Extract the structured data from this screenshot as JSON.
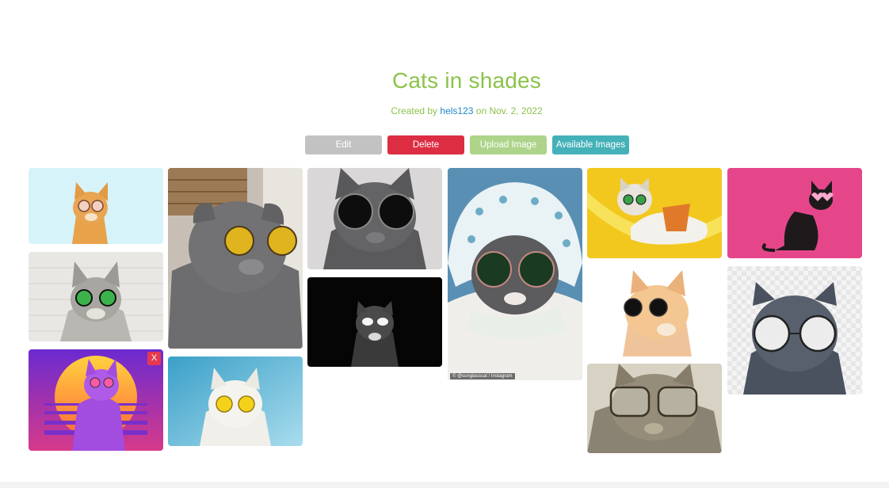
{
  "page": {
    "title": "Cats in shades",
    "created_prefix": "Created by ",
    "author": "hels123",
    "created_suffix": " on Nov. 2, 2022"
  },
  "actions": {
    "edit_label": "Edit",
    "delete_label": "Delete",
    "upload_label": "Upload Image",
    "available_label": "Available Images"
  },
  "gallery": {
    "delete_glyph": "X",
    "watermark": "© @sunglasscat / Instagram"
  },
  "colors": {
    "title": "#8bc34a",
    "author_link": "#1e88c8",
    "edit": "#c2c2c2",
    "delete": "#dc2d43",
    "upload": "#add48a",
    "available": "#44b1b8"
  }
}
